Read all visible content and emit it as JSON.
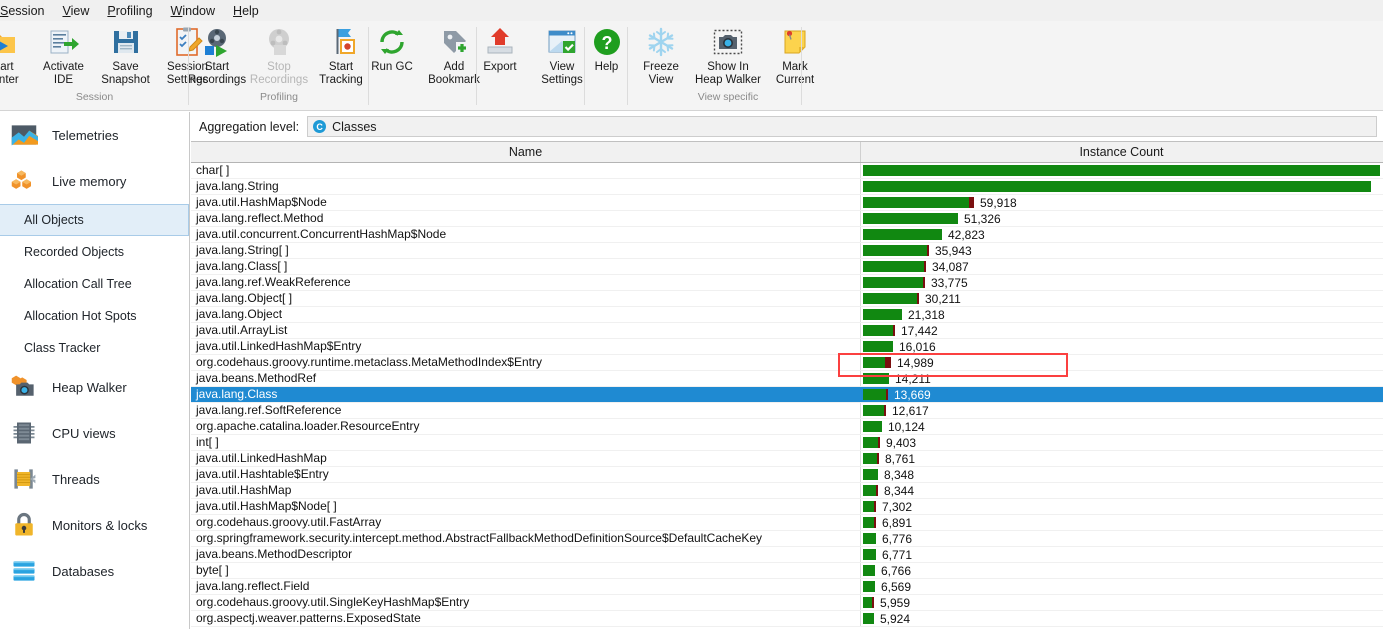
{
  "menu": {
    "items": [
      {
        "label": "Session",
        "mnemonic": "S"
      },
      {
        "label": "View",
        "mnemonic": "V"
      },
      {
        "label": "Profiling",
        "mnemonic": "P"
      },
      {
        "label": "Window",
        "mnemonic": "W"
      },
      {
        "label": "Help",
        "mnemonic": "H"
      }
    ]
  },
  "ribbon": {
    "groups": [
      {
        "name": "Session",
        "label": "Session",
        "buttons": [
          {
            "label": "Start\nCenter",
            "icon": "start-center-icon",
            "disabled": false
          },
          {
            "label": "Activate\nIDE",
            "icon": "activate-ide-icon",
            "disabled": false
          },
          {
            "label": "Save\nSnapshot",
            "icon": "save-snapshot-icon",
            "disabled": false
          },
          {
            "label": "Session\nSettings",
            "icon": "session-settings-icon",
            "disabled": false
          }
        ]
      },
      {
        "name": "Profiling",
        "label": "Profiling",
        "buttons": [
          {
            "label": "Start\nRecordings",
            "icon": "start-recordings-icon",
            "disabled": false
          },
          {
            "label": "Stop\nRecordings",
            "icon": "stop-recordings-icon",
            "disabled": true
          },
          {
            "label": "Start\nTracking",
            "icon": "start-tracking-icon",
            "disabled": false
          }
        ]
      },
      {
        "name": "gc-bookmark",
        "label": "",
        "buttons": [
          {
            "label": "Run GC",
            "icon": "run-gc-icon",
            "disabled": false
          },
          {
            "label": "Add\nBookmark",
            "icon": "add-bookmark-icon",
            "disabled": false
          }
        ]
      },
      {
        "name": "export-settings",
        "label": "",
        "buttons": [
          {
            "label": "Export",
            "icon": "export-icon",
            "disabled": false
          },
          {
            "label": "View\nSettings",
            "icon": "view-settings-icon",
            "disabled": false
          }
        ]
      },
      {
        "name": "help",
        "label": "",
        "buttons": [
          {
            "label": "Help",
            "icon": "help-icon",
            "disabled": false
          }
        ]
      },
      {
        "name": "View specific",
        "label": "View specific",
        "buttons": [
          {
            "label": "Freeze\nView",
            "icon": "freeze-view-icon",
            "disabled": false
          },
          {
            "label": "Show In\nHeap Walker",
            "icon": "show-in-heap-walker-icon",
            "disabled": false
          },
          {
            "label": "Mark\nCurrent",
            "icon": "mark-current-icon",
            "disabled": false
          }
        ]
      }
    ]
  },
  "sidebar": {
    "sections": [
      {
        "type": "main",
        "label": "Telemetries",
        "icon": "telemetries-icon",
        "selected": false
      },
      {
        "type": "main",
        "label": "Live memory",
        "icon": "live-memory-icon",
        "selected": false
      },
      {
        "type": "sub",
        "label": "All Objects",
        "selected": true
      },
      {
        "type": "sub",
        "label": "Recorded Objects",
        "selected": false
      },
      {
        "type": "sub",
        "label": "Allocation Call Tree",
        "selected": false
      },
      {
        "type": "sub",
        "label": "Allocation Hot Spots",
        "selected": false
      },
      {
        "type": "sub",
        "label": "Class Tracker",
        "selected": false
      },
      {
        "type": "main",
        "label": "Heap Walker",
        "icon": "heap-walker-icon",
        "selected": false
      },
      {
        "type": "main",
        "label": "CPU views",
        "icon": "cpu-views-icon",
        "selected": false
      },
      {
        "type": "main",
        "label": "Threads",
        "icon": "threads-icon",
        "selected": false
      },
      {
        "type": "main",
        "label": "Monitors & locks",
        "icon": "monitors-locks-icon",
        "selected": false
      },
      {
        "type": "main",
        "label": "Databases",
        "icon": "databases-icon",
        "selected": false
      }
    ]
  },
  "aggregation": {
    "label": "Aggregation level:",
    "value": "Classes",
    "badge": "C"
  },
  "table": {
    "columns": [
      "Name",
      "Instance Count"
    ],
    "selected_row_index": 14,
    "annotated_row_index": 12,
    "colors": {
      "bar_green": "#118811",
      "bar_dark": "#7b0f0f",
      "selection": "#1f8ad2",
      "annotation": "#fb4040"
    },
    "rows": [
      {
        "name": "char[ ]",
        "count": "",
        "value": 280000,
        "dark": 0
      },
      {
        "name": "java.lang.String",
        "count": "",
        "value": 275000,
        "dark": 0
      },
      {
        "name": "java.util.HashMap$Node",
        "count": "59,918",
        "value": 59918,
        "dark": 2500
      },
      {
        "name": "java.lang.reflect.Method",
        "count": "51,326",
        "value": 51326,
        "dark": 0
      },
      {
        "name": "java.util.concurrent.ConcurrentHashMap$Node",
        "count": "42,823",
        "value": 42823,
        "dark": 0
      },
      {
        "name": "java.lang.String[ ]",
        "count": "35,943",
        "value": 35943,
        "dark": 500
      },
      {
        "name": "java.lang.Class[ ]",
        "count": "34,087",
        "value": 34087,
        "dark": 400
      },
      {
        "name": "java.lang.ref.WeakReference",
        "count": "33,775",
        "value": 33775,
        "dark": 400
      },
      {
        "name": "java.lang.Object[ ]",
        "count": "30,211",
        "value": 30211,
        "dark": 1100
      },
      {
        "name": "java.lang.Object",
        "count": "21,318",
        "value": 21318,
        "dark": 0
      },
      {
        "name": "java.util.ArrayList",
        "count": "17,442",
        "value": 17442,
        "dark": 400
      },
      {
        "name": "java.util.LinkedHashMap$Entry",
        "count": "16,016",
        "value": 16016,
        "dark": 0
      },
      {
        "name": "org.codehaus.groovy.runtime.metaclass.MetaMethodIndex$Entry",
        "count": "14,989",
        "value": 14989,
        "dark": 3200
      },
      {
        "name": "java.beans.MethodRef",
        "count": "14,211",
        "value": 14211,
        "dark": 0
      },
      {
        "name": "java.lang.Class",
        "count": "13,669",
        "value": 13669,
        "dark": 500
      },
      {
        "name": "java.lang.ref.SoftReference",
        "count": "12,617",
        "value": 12617,
        "dark": 400
      },
      {
        "name": "org.apache.catalina.loader.ResourceEntry",
        "count": "10,124",
        "value": 10124,
        "dark": 0
      },
      {
        "name": "int[ ]",
        "count": "9,403",
        "value": 9403,
        "dark": 400
      },
      {
        "name": "java.util.LinkedHashMap",
        "count": "8,761",
        "value": 8761,
        "dark": 400
      },
      {
        "name": "java.util.Hashtable$Entry",
        "count": "8,348",
        "value": 8348,
        "dark": 0
      },
      {
        "name": "java.util.HashMap",
        "count": "8,344",
        "value": 8344,
        "dark": 400
      },
      {
        "name": "java.util.HashMap$Node[ ]",
        "count": "7,302",
        "value": 7302,
        "dark": 400
      },
      {
        "name": "org.codehaus.groovy.util.FastArray",
        "count": "6,891",
        "value": 6891,
        "dark": 900
      },
      {
        "name": "org.springframework.security.intercept.method.AbstractFallbackMethodDefinitionSource$DefaultCacheKey",
        "count": "6,776",
        "value": 6776,
        "dark": 0
      },
      {
        "name": "java.beans.MethodDescriptor",
        "count": "6,771",
        "value": 6771,
        "dark": 0
      },
      {
        "name": "byte[ ]",
        "count": "6,766",
        "value": 6766,
        "dark": 0
      },
      {
        "name": "java.lang.reflect.Field",
        "count": "6,569",
        "value": 6569,
        "dark": 0
      },
      {
        "name": "org.codehaus.groovy.util.SingleKeyHashMap$Entry",
        "count": "5,959",
        "value": 5959,
        "dark": 1300
      },
      {
        "name": "org.aspectj.weaver.patterns.ExposedState",
        "count": "5,924",
        "value": 5924,
        "dark": 0
      }
    ]
  }
}
